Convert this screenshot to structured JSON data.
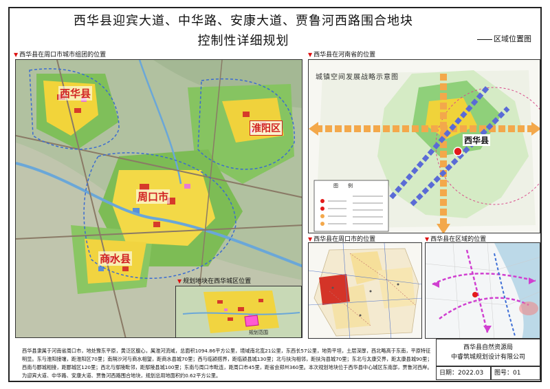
{
  "title": {
    "line1": "西华县迎宾大道、中华路、安康大道、贾鲁河西路围合地块",
    "line2": "控制性详细规划",
    "sheet_name": "区域位置图"
  },
  "panels": {
    "zhoukou": {
      "caption": "西华县在周口市城市组团的位置"
    },
    "henan": {
      "caption": "西华县在河南省的位置",
      "subtitle": "城镇空间发展战略示意图"
    },
    "city": {
      "caption": "西华县在周口市的位置"
    },
    "region": {
      "caption": "西华县在区域的位置"
    },
    "inset": {
      "caption": "规划地块在西华城区位置",
      "label": "规划范围"
    }
  },
  "labels": {
    "xihua": "西华县",
    "huaiyang": "淮阳区",
    "zhoukou": "周口市",
    "shangshui": "商水县",
    "xihua2": "西华县"
  },
  "legend": {
    "title": "图　　例"
  },
  "description": "西华县隶属于河南省周口市，地处豫东平原，黄泛区腹心，属淮河流域，总面积1094.86平方公里，境域南北宽21公里，东西长57公里，地势平坦，土层深厚，西北略高于东南，平原特征明显。东与淮阳接壤，距淮阳区70里；南隔沙河与商水相望，距商水县城70里；西与临颍搭界，距临颍县城130里；北与扶沟相邻，距扶沟县城70里；东北与太康交界，距太康县城90里；西南与郾城相接，距郾城区120里；西北与鄢陵毗邻，距鄢陵县城100里；东南与周口市毗连，距周口市45里，距省会郑州360里。本次规划地块位于西华县中心城区东南部，贾鲁河西岸。为迎宾大道、中华路、安康大道、贾鲁河西路围合地块，规划总用地面积约0.62平方公里。",
  "footer": {
    "org1": "西华县自然资源局",
    "org2": "中睿筑城规划设计有限公司",
    "date": "日期：2022.03",
    "figno": "图号：01"
  },
  "colors": {
    "accent": "#d11a1a",
    "caption_marker": "#d11a1a"
  }
}
